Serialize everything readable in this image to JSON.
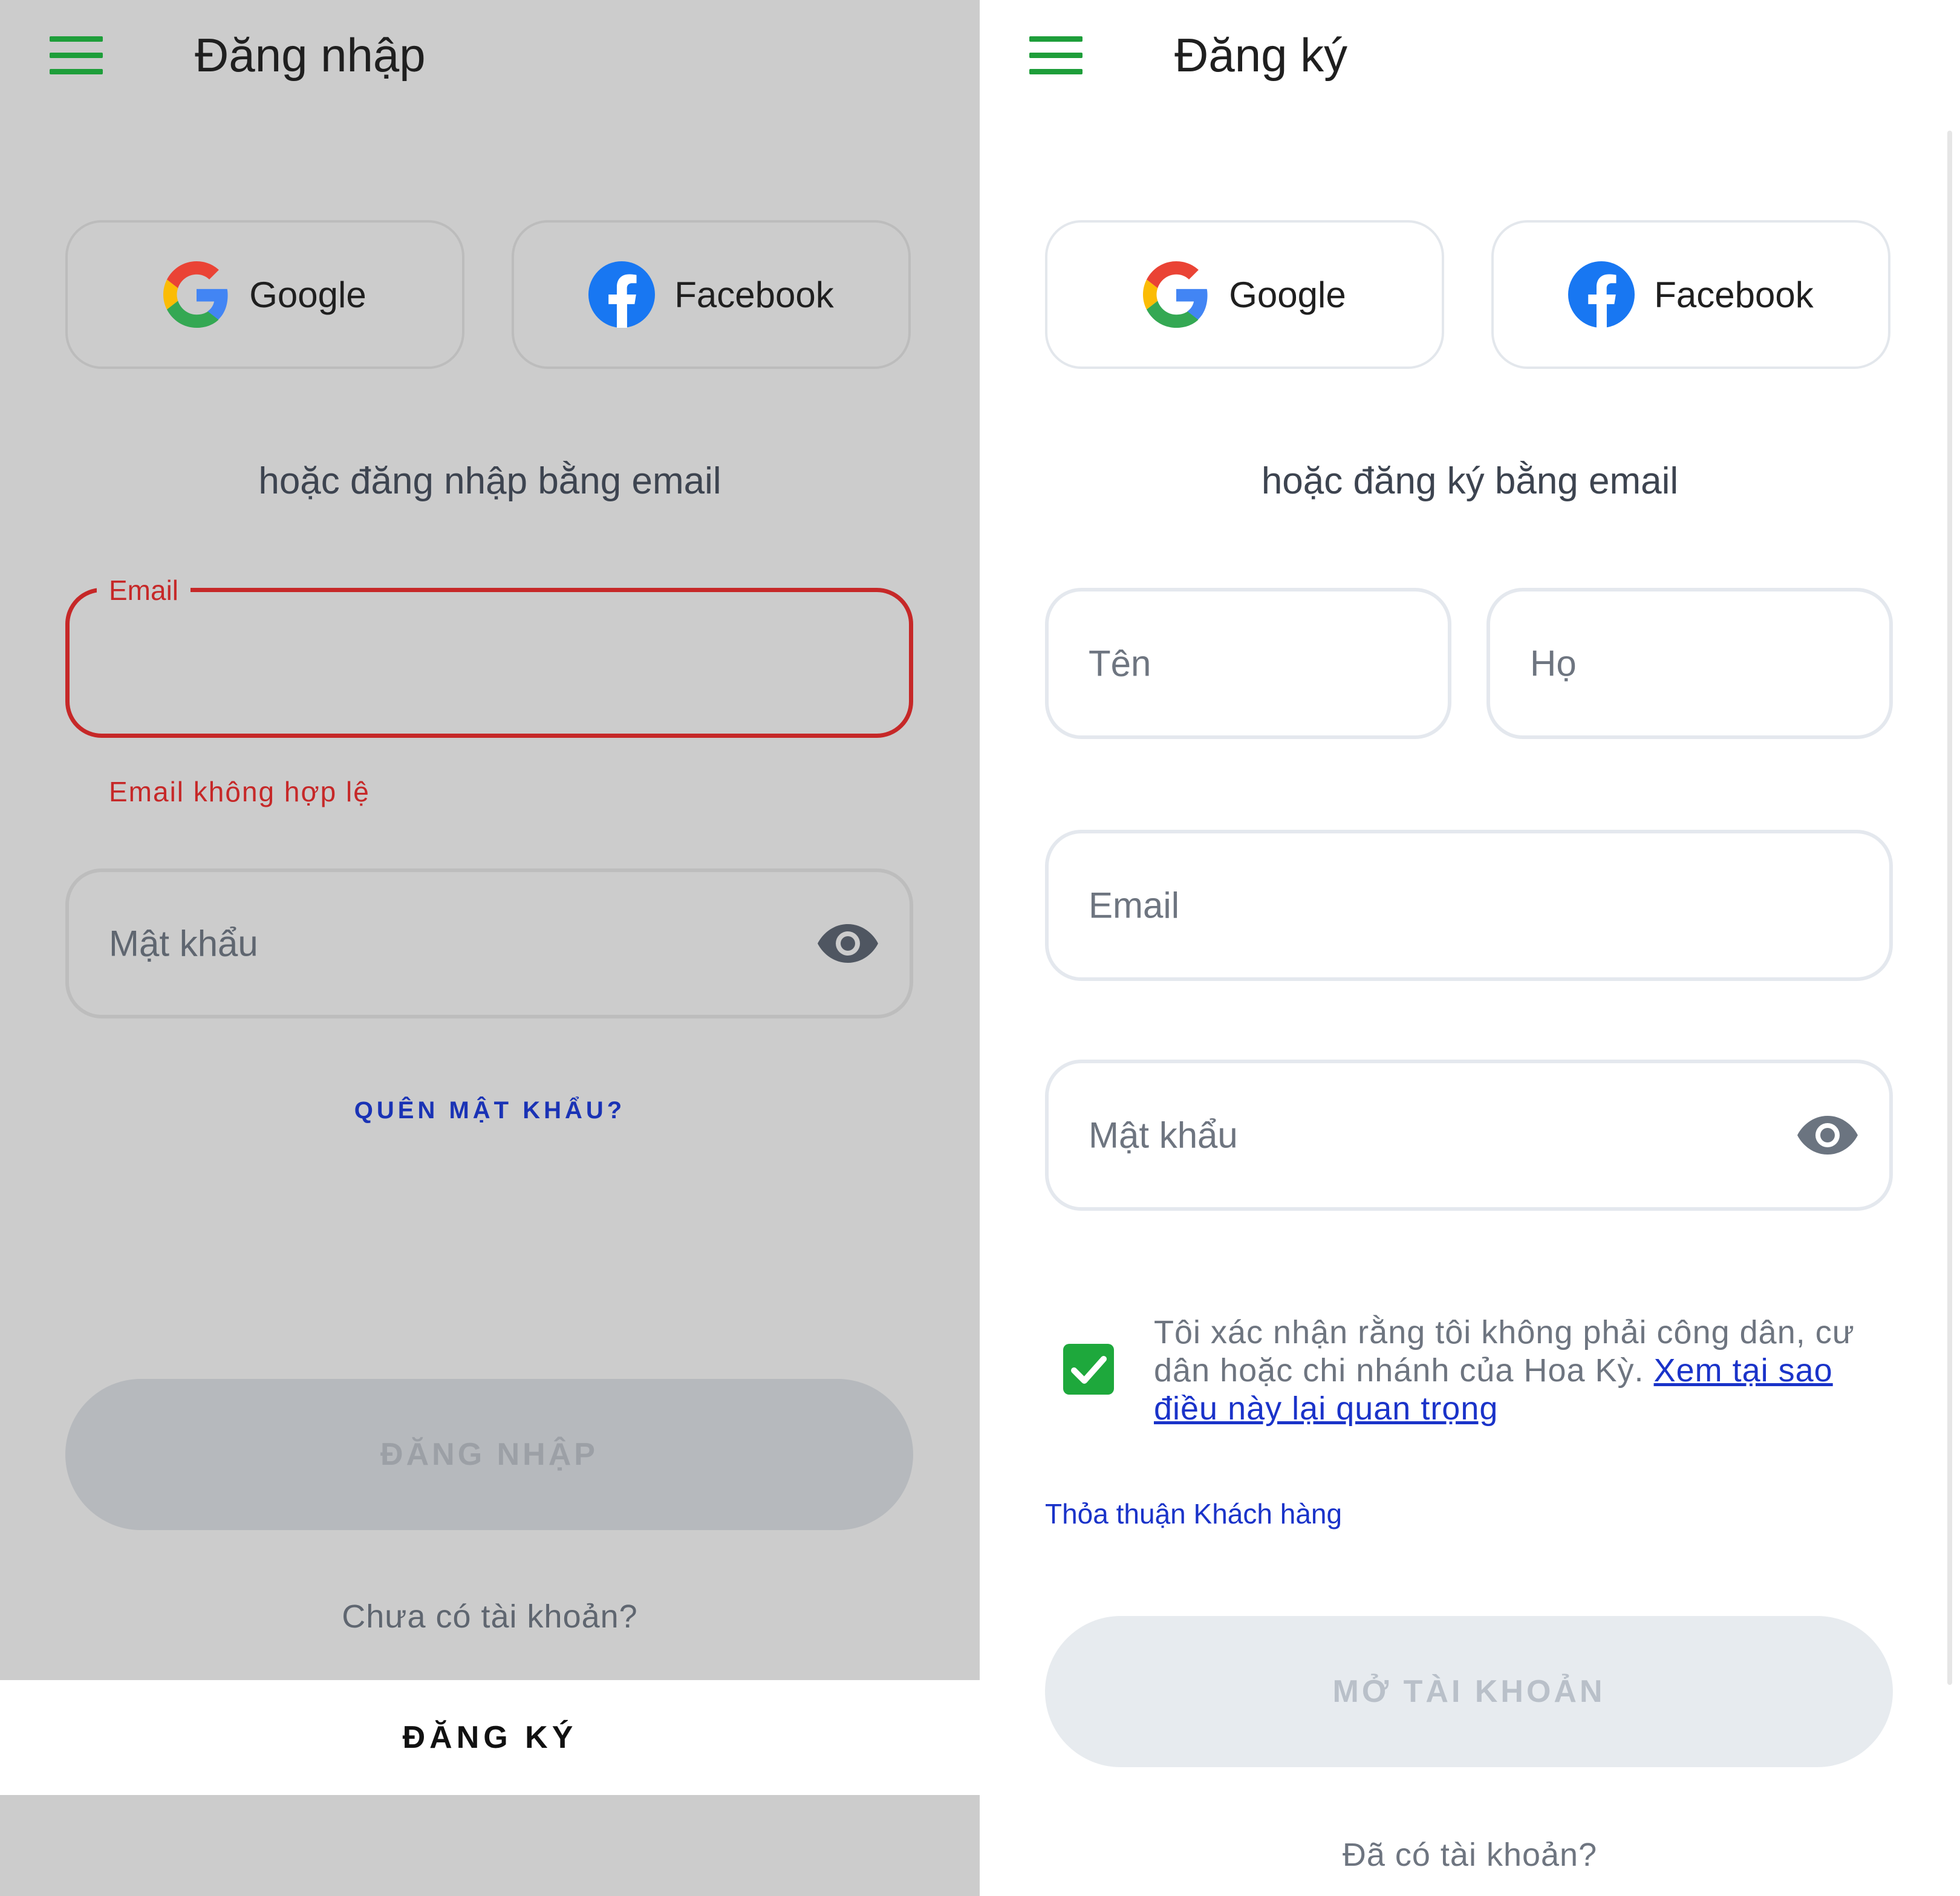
{
  "login": {
    "title": "Đăng nhập",
    "google_label": "Google",
    "facebook_label": "Facebook",
    "or_text": "hoặc đăng nhập bằng email",
    "email_label": "Email",
    "email_value": "",
    "email_error": "Email không hợp lệ",
    "password_placeholder": "Mật khẩu",
    "forgot_password": "QUÊN MẬT KHẨU?",
    "login_button": "ĐĂNG NHẬP",
    "no_account": "Chưa có tài khoản?",
    "register_button": "ĐĂNG KÝ"
  },
  "register": {
    "title": "Đăng ký",
    "google_label": "Google",
    "facebook_label": "Facebook",
    "or_text": "hoặc đăng ký bằng email",
    "first_name_placeholder": "Tên",
    "last_name_placeholder": "Họ",
    "email_placeholder": "Email",
    "password_placeholder": "Mật khẩu",
    "consent_text": "Tôi xác nhận rằng tôi không phải công dân, cư dân hoặc chi nhánh của Hoa Kỳ. ",
    "consent_link": "Xem tại sao điều này lại quan trọng",
    "consent_checked": true,
    "agreement_link": "Thỏa thuận Khách hàng",
    "open_account_button": "MỞ TÀI KHOẢN",
    "have_account": "Đã có tài khoản?"
  },
  "colors": {
    "brand_green": "#1e9e3a",
    "error_red": "#c62828",
    "link_blue": "#1a33c9",
    "overlay_gray": "#cccccc",
    "checkbox_green": "#1ea83c"
  },
  "icons": [
    "menu-icon",
    "google-icon",
    "facebook-icon",
    "eye-icon",
    "check-icon"
  ]
}
